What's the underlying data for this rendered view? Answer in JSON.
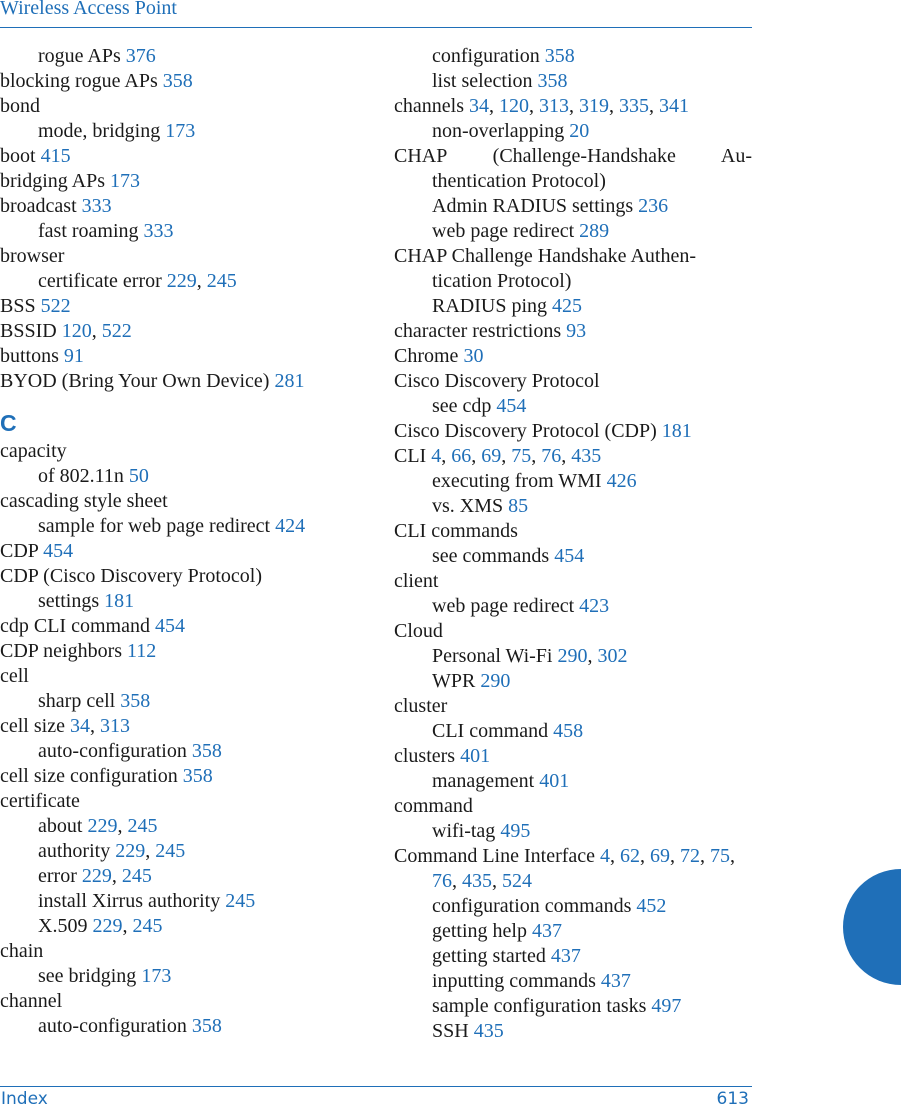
{
  "header": {
    "title": "Wireless Access Point"
  },
  "footer": {
    "section": "Index",
    "page_number": "613"
  },
  "accent_color": "#1f6fb8",
  "columns": [
    {
      "entries": [
        {
          "type": "sub",
          "term": "rogue APs",
          "pages": [
            "376"
          ]
        },
        {
          "type": "main",
          "term": "blocking rogue APs",
          "pages": [
            "358"
          ]
        },
        {
          "type": "main",
          "term": "bond",
          "pages": []
        },
        {
          "type": "sub",
          "term": "mode, bridging",
          "pages": [
            "173"
          ]
        },
        {
          "type": "main",
          "term": "boot",
          "pages": [
            "415"
          ]
        },
        {
          "type": "main",
          "term": "bridging APs",
          "pages": [
            "173"
          ]
        },
        {
          "type": "main",
          "term": "broadcast",
          "pages": [
            "333"
          ]
        },
        {
          "type": "sub",
          "term": "fast roaming",
          "pages": [
            "333"
          ]
        },
        {
          "type": "main",
          "term": "browser",
          "pages": []
        },
        {
          "type": "sub",
          "term": "certificate error",
          "pages": [
            "229",
            "245"
          ]
        },
        {
          "type": "main",
          "term": "BSS",
          "pages": [
            "522"
          ]
        },
        {
          "type": "main",
          "term": "BSSID",
          "pages": [
            "120",
            "522"
          ]
        },
        {
          "type": "main",
          "term": "buttons",
          "pages": [
            "91"
          ]
        },
        {
          "type": "main",
          "term": "BYOD (Bring Your Own Device)",
          "pages": [
            "281"
          ]
        },
        {
          "type": "letter",
          "term": "C"
        },
        {
          "type": "main",
          "term": "capacity",
          "pages": []
        },
        {
          "type": "sub",
          "term": "of 802.11n",
          "pages": [
            "50"
          ]
        },
        {
          "type": "main",
          "term": "cascading style sheet",
          "pages": []
        },
        {
          "type": "sub",
          "term": "sample for web page redirect",
          "pages": [
            "424"
          ]
        },
        {
          "type": "main",
          "term": "CDP",
          "pages": [
            "454"
          ]
        },
        {
          "type": "main",
          "term": "CDP (Cisco Discovery Protocol)",
          "pages": []
        },
        {
          "type": "sub",
          "term": "settings",
          "pages": [
            "181"
          ]
        },
        {
          "type": "main",
          "term": "cdp CLI command",
          "pages": [
            "454"
          ]
        },
        {
          "type": "main",
          "term": "CDP neighbors",
          "pages": [
            "112"
          ]
        },
        {
          "type": "main",
          "term": "cell",
          "pages": []
        },
        {
          "type": "sub",
          "term": "sharp cell",
          "pages": [
            "358"
          ]
        },
        {
          "type": "main",
          "term": "cell size",
          "pages": [
            "34",
            "313"
          ]
        },
        {
          "type": "sub",
          "term": "auto-configuration",
          "pages": [
            "358"
          ]
        },
        {
          "type": "main",
          "term": "cell size configuration",
          "pages": [
            "358"
          ]
        },
        {
          "type": "main",
          "term": "certificate",
          "pages": []
        },
        {
          "type": "sub",
          "term": "about",
          "pages": [
            "229",
            "245"
          ]
        },
        {
          "type": "sub",
          "term": "authority",
          "pages": [
            "229",
            "245"
          ]
        },
        {
          "type": "sub",
          "term": "error",
          "pages": [
            "229",
            "245"
          ]
        },
        {
          "type": "sub",
          "term": "install Xirrus authority",
          "pages": [
            "245"
          ]
        },
        {
          "type": "sub",
          "term": "X.509",
          "pages": [
            "229",
            "245"
          ]
        },
        {
          "type": "main",
          "term": "chain",
          "pages": []
        },
        {
          "type": "sub",
          "term": "see bridging",
          "pages": [
            "173"
          ]
        },
        {
          "type": "main",
          "term": "channel",
          "pages": []
        },
        {
          "type": "sub",
          "term": "auto-configuration",
          "pages": [
            "358"
          ]
        }
      ]
    },
    {
      "entries": [
        {
          "type": "sub",
          "term": "configuration",
          "pages": [
            "358"
          ]
        },
        {
          "type": "sub",
          "term": "list selection",
          "pages": [
            "358"
          ]
        },
        {
          "type": "main",
          "term": "channels",
          "pages": [
            "34",
            "120",
            "313",
            "319",
            "335",
            "341"
          ]
        },
        {
          "type": "sub",
          "term": "non-overlapping",
          "pages": [
            "20"
          ]
        },
        {
          "type": "main-wrap-justify",
          "term": "CHAP (Challenge-Handshake Au-thentication Protocol)",
          "pages": []
        },
        {
          "type": "sub",
          "term": "Admin RADIUS settings",
          "pages": [
            "236"
          ]
        },
        {
          "type": "sub",
          "term": "web page redirect",
          "pages": [
            "289"
          ]
        },
        {
          "type": "main-wrap",
          "term": "CHAP Challenge Handshake Authen-tication Protocol)",
          "pages": []
        },
        {
          "type": "sub",
          "term": "RADIUS ping",
          "pages": [
            "425"
          ]
        },
        {
          "type": "main",
          "term": "character restrictions",
          "pages": [
            "93"
          ]
        },
        {
          "type": "main",
          "term": "Chrome",
          "pages": [
            "30"
          ]
        },
        {
          "type": "main",
          "term": "Cisco Discovery Protocol",
          "pages": []
        },
        {
          "type": "sub",
          "term": "see cdp",
          "pages": [
            "454"
          ]
        },
        {
          "type": "main",
          "term": "Cisco Discovery Protocol (CDP)",
          "pages": [
            "181"
          ]
        },
        {
          "type": "main",
          "term": "CLI",
          "pages": [
            "4",
            "66",
            "69",
            "75",
            "76",
            "435"
          ]
        },
        {
          "type": "sub",
          "term": "executing from WMI",
          "pages": [
            "426"
          ]
        },
        {
          "type": "sub",
          "term": "vs. XMS",
          "pages": [
            "85"
          ]
        },
        {
          "type": "main",
          "term": "CLI commands",
          "pages": []
        },
        {
          "type": "sub",
          "term": "see commands",
          "pages": [
            "454"
          ]
        },
        {
          "type": "main",
          "term": "client",
          "pages": []
        },
        {
          "type": "sub",
          "term": "web page redirect",
          "pages": [
            "423"
          ]
        },
        {
          "type": "main",
          "term": "Cloud",
          "pages": []
        },
        {
          "type": "sub",
          "term": "Personal Wi-Fi",
          "pages": [
            "290",
            "302"
          ]
        },
        {
          "type": "sub",
          "term": "WPR",
          "pages": [
            "290"
          ]
        },
        {
          "type": "main",
          "term": "cluster",
          "pages": []
        },
        {
          "type": "sub",
          "term": "CLI command",
          "pages": [
            "458"
          ]
        },
        {
          "type": "main",
          "term": "clusters",
          "pages": [
            "401"
          ]
        },
        {
          "type": "sub",
          "term": "management",
          "pages": [
            "401"
          ]
        },
        {
          "type": "main",
          "term": "command",
          "pages": []
        },
        {
          "type": "sub",
          "term": "wifi-tag",
          "pages": [
            "495"
          ]
        },
        {
          "type": "main-wrap",
          "term": "Command Line Interface",
          "pages": [
            "4",
            "62",
            "69",
            "72",
            "75",
            "76",
            "435",
            "524"
          ]
        },
        {
          "type": "sub",
          "term": "configuration commands",
          "pages": [
            "452"
          ]
        },
        {
          "type": "sub",
          "term": "getting help",
          "pages": [
            "437"
          ]
        },
        {
          "type": "sub",
          "term": "getting started",
          "pages": [
            "437"
          ]
        },
        {
          "type": "sub",
          "term": "inputting commands",
          "pages": [
            "437"
          ]
        },
        {
          "type": "sub",
          "term": "sample configuration tasks",
          "pages": [
            "497"
          ]
        },
        {
          "type": "sub",
          "term": "SSH",
          "pages": [
            "435"
          ]
        }
      ]
    }
  ]
}
